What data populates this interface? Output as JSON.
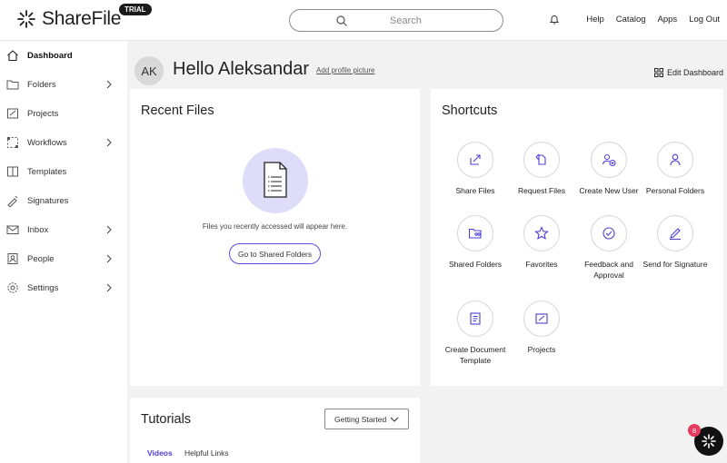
{
  "header": {
    "brand": "ShareFile",
    "badge": "TRIAL",
    "search_placeholder": "Search",
    "links": [
      "Help",
      "Catalog",
      "Apps",
      "Log Out"
    ]
  },
  "sidebar": {
    "items": [
      {
        "label": "Dashboard",
        "icon": "home-icon",
        "active": true,
        "has_submenu": false
      },
      {
        "label": "Folders",
        "icon": "folder-icon",
        "has_submenu": true
      },
      {
        "label": "Projects",
        "icon": "projects-icon",
        "has_submenu": false
      },
      {
        "label": "Workflows",
        "icon": "workflows-icon",
        "has_submenu": true
      },
      {
        "label": "Templates",
        "icon": "templates-icon",
        "has_submenu": false
      },
      {
        "label": "Signatures",
        "icon": "signature-icon",
        "has_submenu": false
      },
      {
        "label": "Inbox",
        "icon": "inbox-icon",
        "has_submenu": true
      },
      {
        "label": "People",
        "icon": "people-icon",
        "has_submenu": true
      },
      {
        "label": "Settings",
        "icon": "gear-icon",
        "has_submenu": true
      }
    ]
  },
  "welcome": {
    "initials": "AK",
    "greeting": "Hello Aleksandar",
    "add_picture": "Add profile picture",
    "edit_dashboard": "Edit Dashboard"
  },
  "recent_files": {
    "title": "Recent Files",
    "message": "Files you recently accessed will appear here.",
    "button": "Go to Shared Folders"
  },
  "shortcuts": {
    "title": "Shortcuts",
    "items": [
      {
        "label": "Share Files",
        "icon": "share-icon"
      },
      {
        "label": "Request Files",
        "icon": "request-icon"
      },
      {
        "label": "Create New User",
        "icon": "add-user-icon"
      },
      {
        "label": "Personal Folders",
        "icon": "person-icon"
      },
      {
        "label": "Shared Folders",
        "icon": "shared-folder-icon"
      },
      {
        "label": "Favorites",
        "icon": "star-icon"
      },
      {
        "label": "Feedback and Approval",
        "icon": "check-circle-icon"
      },
      {
        "label": "Send for Signature",
        "icon": "pen-icon"
      },
      {
        "label": "Create Document Template",
        "icon": "document-icon"
      },
      {
        "label": "Projects",
        "icon": "projects-icon"
      }
    ]
  },
  "tutorials": {
    "title": "Tutorials",
    "select_value": "Getting Started",
    "tabs": [
      "Videos",
      "Helpful Links"
    ]
  },
  "assistant": {
    "badge_count": "8"
  },
  "colors": {
    "accent": "#5b4ee0",
    "file_circle": "#ddddf9",
    "badge": "#e63a5e"
  }
}
